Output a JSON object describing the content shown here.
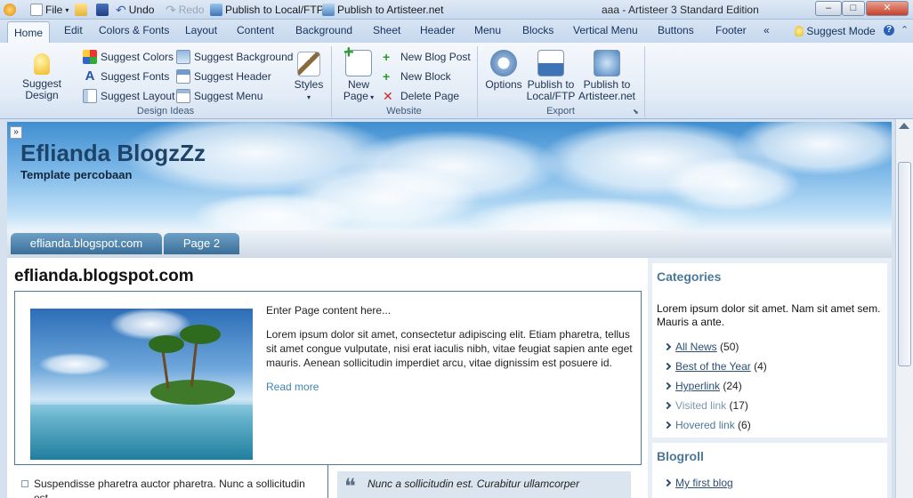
{
  "quick_access": {
    "file": "File",
    "undo": "Undo",
    "redo": "Redo",
    "publish_local": "Publish to Local/FTP",
    "publish_artisteer": "Publish to Artisteer.net"
  },
  "window": {
    "title": "aaa - Artisteer 3 Standard Edition",
    "minimize": "–",
    "maximize": "□",
    "close": "✕"
  },
  "tabs": [
    "Home",
    "Edit",
    "Colors & Fonts",
    "Layout",
    "Content",
    "Background",
    "Sheet",
    "Header",
    "Menu",
    "Blocks",
    "Vertical Menu",
    "Buttons",
    "Footer",
    "«"
  ],
  "suggest_mode": "Suggest Mode",
  "ribbon": {
    "design_ideas": {
      "label": "Design Ideas",
      "suggest_design": "Suggest Design",
      "suggest_colors": "Suggest Colors",
      "suggest_fonts": "Suggest Fonts",
      "suggest_layout": "Suggest Layout",
      "suggest_background": "Suggest Background",
      "suggest_header": "Suggest Header",
      "suggest_menu": "Suggest Menu",
      "styles": "Styles"
    },
    "website": {
      "label": "Website",
      "new_page_1": "New",
      "new_page_2": "Page",
      "new_blog_post": "New Blog Post",
      "new_block": "New Block",
      "delete_page": "Delete Page"
    },
    "export": {
      "label": "Export",
      "options": "Options",
      "publish_local_1": "Publish to",
      "publish_local_2": "Local/FTP",
      "publish_artisteer_1": "Publish to",
      "publish_artisteer_2": "Artisteer.net"
    }
  },
  "site": {
    "title": "Eflianda BlogzZz",
    "slogan": "Template percobaan",
    "expand": "»",
    "nav": [
      "eflianda.blogspot.com",
      "Page 2"
    ]
  },
  "post": {
    "title": "eflianda.blogspot.com",
    "intro": "Enter Page content here...",
    "body": "Lorem ipsum dolor sit amet, consectetur adipiscing elit. Etiam pharetra, tellus sit amet congue vulputate, nisi erat iaculis nibh, vitae feugiat sapien ante eget mauris. Aenean sollicitudin imperdiet arcu, vitae dignissim est posuere id.",
    "read_more": "Read more",
    "list_item": "Suspendisse pharetra auctor pharetra. Nunc a sollicitudin est.",
    "quote": "Nunc a sollicitudin est. Curabitur ullamcorper"
  },
  "sidebar": {
    "categories_title": "Categories",
    "categories_text": "Lorem ipsum dolor sit amet. Nam sit amet sem. Mauris a ante.",
    "categories": [
      {
        "label": "All News",
        "count": "(50)"
      },
      {
        "label": "Best of the Year",
        "count": "(4)"
      },
      {
        "label": "Hyperlink",
        "count": "(24)"
      },
      {
        "label": "Visited link",
        "count": "(17)"
      },
      {
        "label": "Hovered link",
        "count": "(6)"
      }
    ],
    "blogroll_title": "Blogroll",
    "blogroll": [
      {
        "label": "My first blog"
      }
    ]
  }
}
